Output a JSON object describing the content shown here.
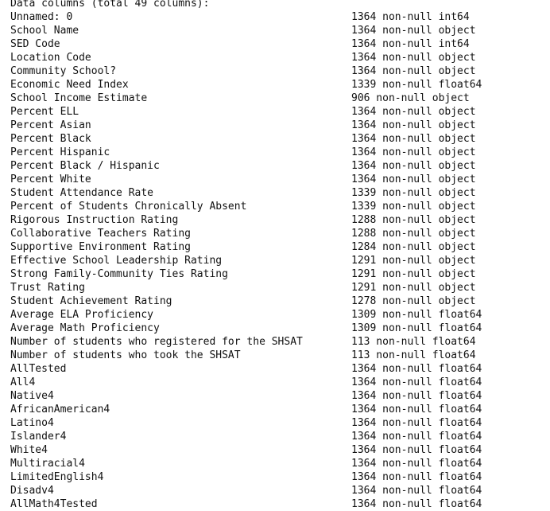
{
  "header": "Data columns (total 49 columns):",
  "columns": [
    {
      "name": "Unnamed: 0",
      "info": "1364 non-null int64"
    },
    {
      "name": "School Name",
      "info": "1364 non-null object"
    },
    {
      "name": "SED Code",
      "info": "1364 non-null int64"
    },
    {
      "name": "Location Code",
      "info": "1364 non-null object"
    },
    {
      "name": "Community School?",
      "info": "1364 non-null object"
    },
    {
      "name": "Economic Need Index",
      "info": "1339 non-null float64"
    },
    {
      "name": "School Income Estimate",
      "info": "906 non-null object"
    },
    {
      "name": "Percent ELL",
      "info": "1364 non-null object"
    },
    {
      "name": "Percent Asian",
      "info": "1364 non-null object"
    },
    {
      "name": "Percent Black",
      "info": "1364 non-null object"
    },
    {
      "name": "Percent Hispanic",
      "info": "1364 non-null object"
    },
    {
      "name": "Percent Black / Hispanic",
      "info": "1364 non-null object"
    },
    {
      "name": "Percent White",
      "info": "1364 non-null object"
    },
    {
      "name": "Student Attendance Rate",
      "info": "1339 non-null object"
    },
    {
      "name": "Percent of Students Chronically Absent",
      "info": "1339 non-null object"
    },
    {
      "name": "Rigorous Instruction Rating",
      "info": "1288 non-null object"
    },
    {
      "name": "Collaborative Teachers Rating",
      "info": "1288 non-null object"
    },
    {
      "name": "Supportive Environment Rating",
      "info": "1284 non-null object"
    },
    {
      "name": "Effective School Leadership Rating",
      "info": "1291 non-null object"
    },
    {
      "name": "Strong Family-Community Ties Rating",
      "info": "1291 non-null object"
    },
    {
      "name": "Trust Rating",
      "info": "1291 non-null object"
    },
    {
      "name": "Student Achievement Rating",
      "info": "1278 non-null object"
    },
    {
      "name": "Average ELA Proficiency",
      "info": "1309 non-null float64"
    },
    {
      "name": "Average Math Proficiency",
      "info": "1309 non-null float64"
    },
    {
      "name": "Number of students who registered for the SHSAT",
      "info": "113 non-null float64"
    },
    {
      "name": "Number of students who took the SHSAT",
      "info": "113 non-null float64"
    },
    {
      "name": "AllTested",
      "info": "1364 non-null float64"
    },
    {
      "name": "All4",
      "info": "1364 non-null float64"
    },
    {
      "name": "Native4",
      "info": "1364 non-null float64"
    },
    {
      "name": "AfricanAmerican4",
      "info": "1364 non-null float64"
    },
    {
      "name": "Latino4",
      "info": "1364 non-null float64"
    },
    {
      "name": "Islander4",
      "info": "1364 non-null float64"
    },
    {
      "name": "White4",
      "info": "1364 non-null float64"
    },
    {
      "name": "Multiracial4",
      "info": "1364 non-null float64"
    },
    {
      "name": "LimitedEnglish4",
      "info": "1364 non-null float64"
    },
    {
      "name": "Disadv4",
      "info": "1364 non-null float64"
    },
    {
      "name": "AllMath4Tested",
      "info": "1364 non-null float64"
    }
  ]
}
